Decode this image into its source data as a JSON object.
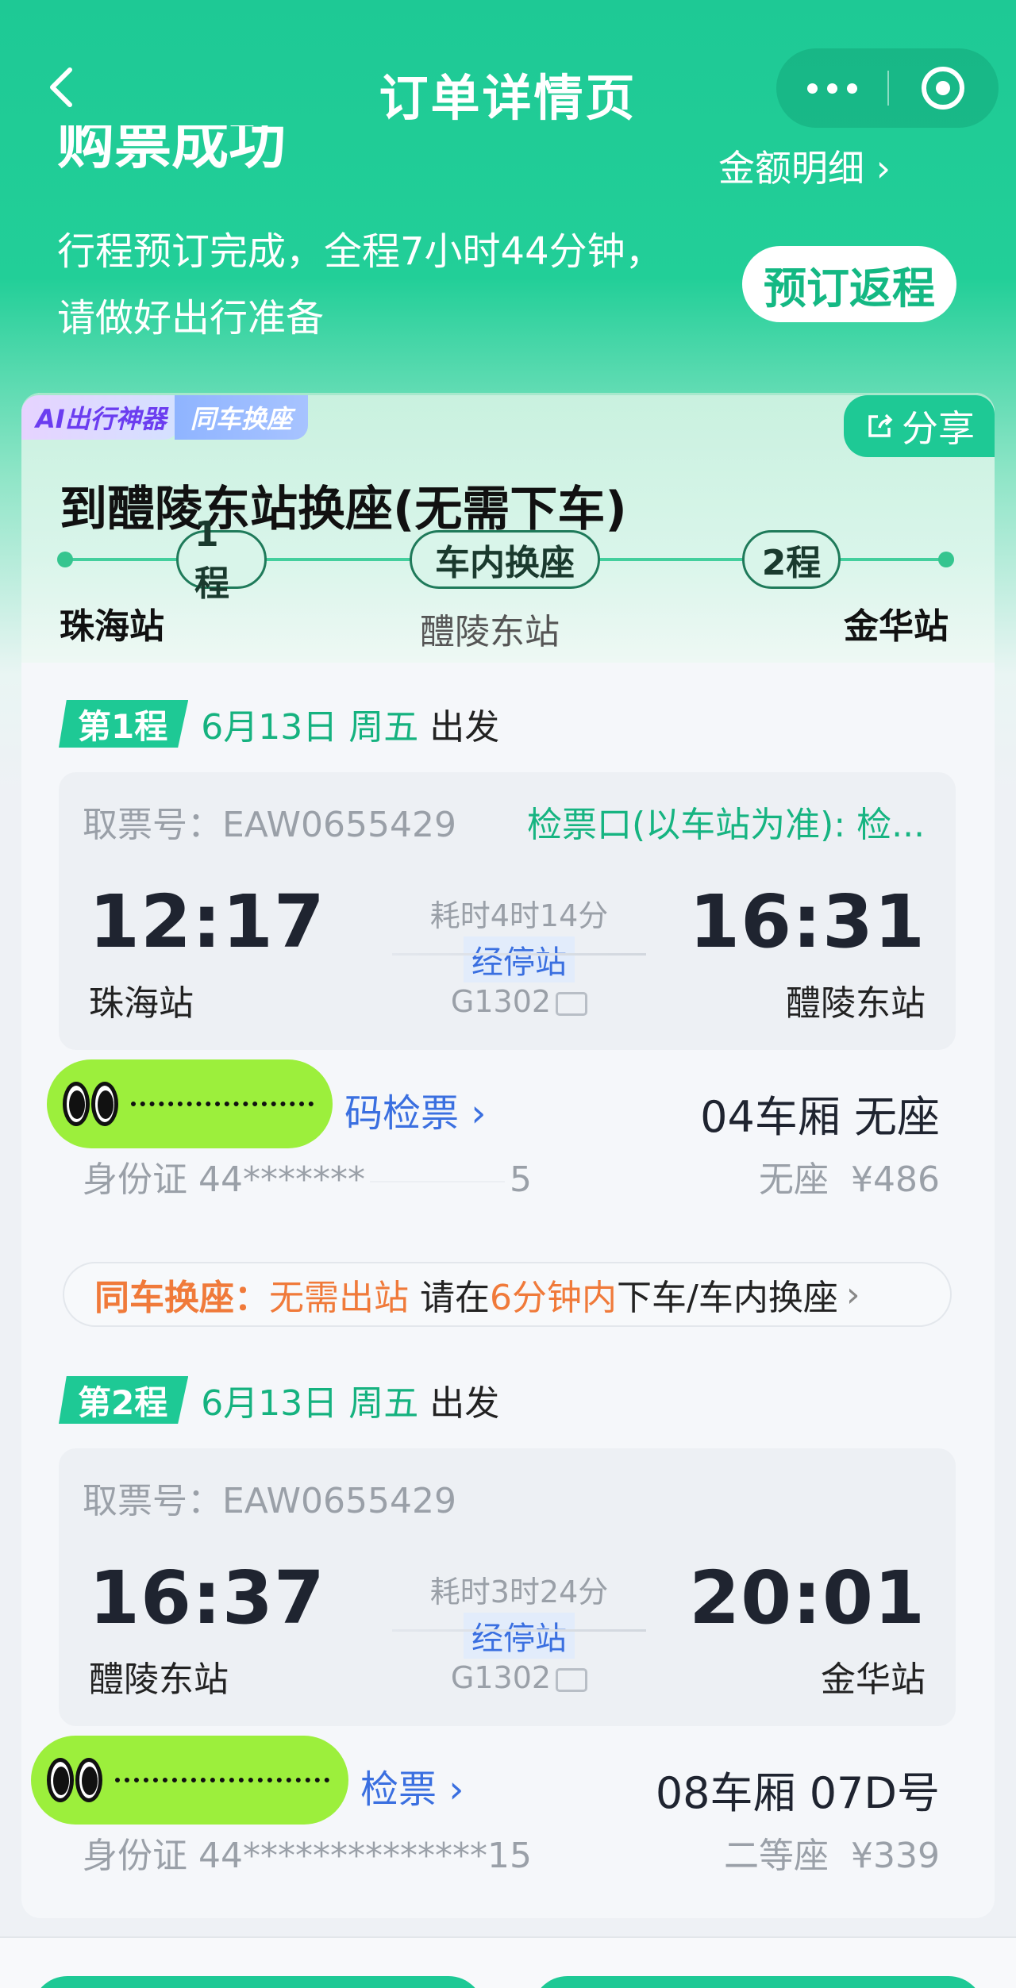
{
  "nav": {
    "title": "订单详情页",
    "back_icon": "chevron-left-icon"
  },
  "hero": {
    "title": "购票成功",
    "amount_detail": "金额明细",
    "desc": "行程预订完成，全程7小时44分钟，请做好出行准备",
    "rebook": "预订返程"
  },
  "card": {
    "tag_ai": "AI出行神器",
    "tag_seat": "同车换座",
    "share": "分享",
    "route_title": "到醴陵东站换座(无需下车)",
    "pill1": "1程",
    "pill_mid": "车内换座",
    "pill2": "2程",
    "from": "珠海站",
    "mid": "醴陵东站",
    "to": "金华站"
  },
  "legs": [
    {
      "badge": "第1程",
      "date": "6月13日 周五",
      "go": "出发",
      "ticket_no": "取票号：EAW0655429",
      "check_gate": "检票口(以车站为准): 检...",
      "dep_time": "12:17",
      "dep_station": "珠海站",
      "duration": "耗时4时14分",
      "stops": "经停站",
      "train": "G1302",
      "arr_time": "16:31",
      "arr_station": "醴陵东站",
      "qr": "码检票",
      "seat": "04车厢 无座",
      "id": "身份证 44*******",
      "id_tail": "5",
      "seat_type": "无座",
      "price": "¥486"
    },
    {
      "badge": "第2程",
      "date": "6月13日 周五",
      "go": "出发",
      "ticket_no": "取票号：EAW0655429",
      "dep_time": "16:37",
      "dep_station": "醴陵东站",
      "duration": "耗时3时24分",
      "stops": "经停站",
      "train": "G1302",
      "arr_time": "20:01",
      "arr_station": "金华站",
      "qr": "检票",
      "seat": "08车厢 07D号",
      "id": "身份证 44**************15",
      "seat_type": "二等座",
      "price": "¥339"
    }
  ],
  "transfer": {
    "label": "同车换座：",
    "no_exit": "无需出站",
    "please": "请在",
    "minutes": "6分钟内",
    "rest": "下车/车内换座"
  },
  "colors": {
    "brand": "#1ec995",
    "link": "#3a6fe0",
    "warn": "#f07a3a"
  }
}
